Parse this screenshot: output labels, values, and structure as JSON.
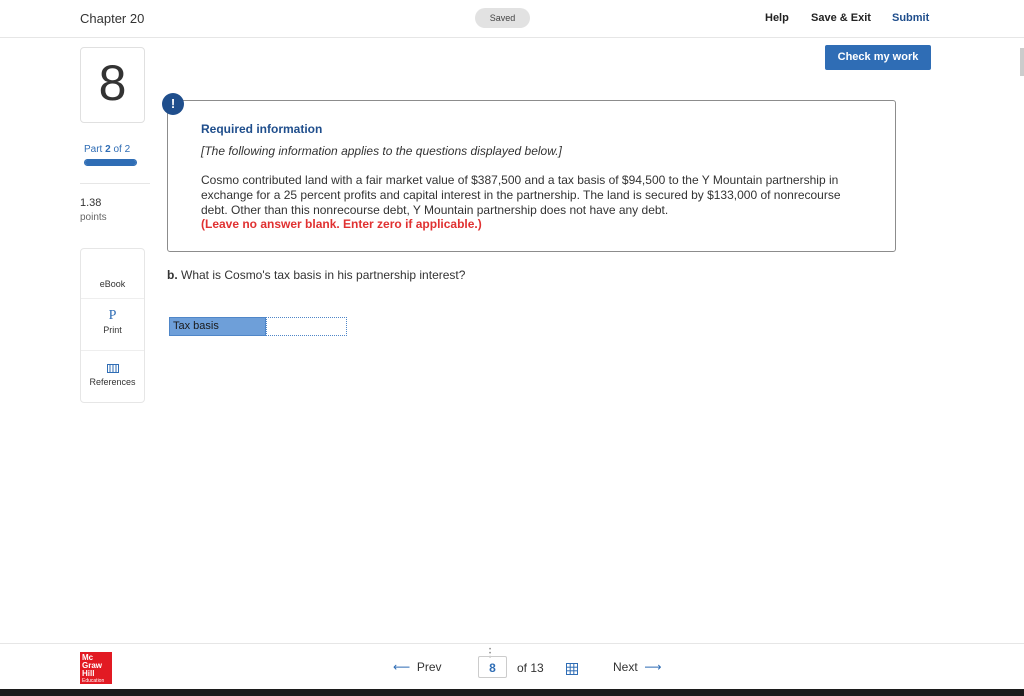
{
  "header": {
    "chapter": "Chapter 20",
    "saved": "Saved",
    "help": "Help",
    "save_exit": "Save & Exit",
    "submit": "Submit",
    "check_work": "Check my work"
  },
  "sidebar": {
    "question_number": "8",
    "part_prefix": "Part ",
    "part_current": "2",
    "part_suffix": " of 2",
    "part_progress": 1.0,
    "points_value": "1.38",
    "points_label": "points",
    "tools": {
      "ebook": "eBook",
      "print_glyph": "P",
      "print": "Print",
      "references": "References"
    }
  },
  "info": {
    "alert_glyph": "!",
    "title": "Required information",
    "subtitle": "[The following information applies to the questions displayed below.]",
    "body": "Cosmo contributed land with a fair market value of $387,500 and a tax basis of $94,500 to the Y Mountain partnership in exchange for a 25 percent profits and capital interest in the partnership. The land is secured by $133,000 of nonrecourse debt. Other than this nonrecourse debt, Y Mountain partnership does not have any debt.",
    "warning": "(Leave no answer blank. Enter zero if applicable.)"
  },
  "question": {
    "prefix": "b.",
    "text": " What is Cosmo's tax basis in his partnership interest?"
  },
  "answer": {
    "label": "Tax basis",
    "value": ""
  },
  "footer": {
    "logo_line1": "Mc",
    "logo_line2": "Graw",
    "logo_line3": "Hill",
    "logo_line4": "Education",
    "prev": "Prev",
    "page_current": "8",
    "page_of": "of 13",
    "next": "Next"
  },
  "colors": {
    "brand_blue": "#2f6db5",
    "title_blue": "#1f4e8c",
    "warning_red": "#e03131",
    "logo_red": "#e21a23"
  }
}
